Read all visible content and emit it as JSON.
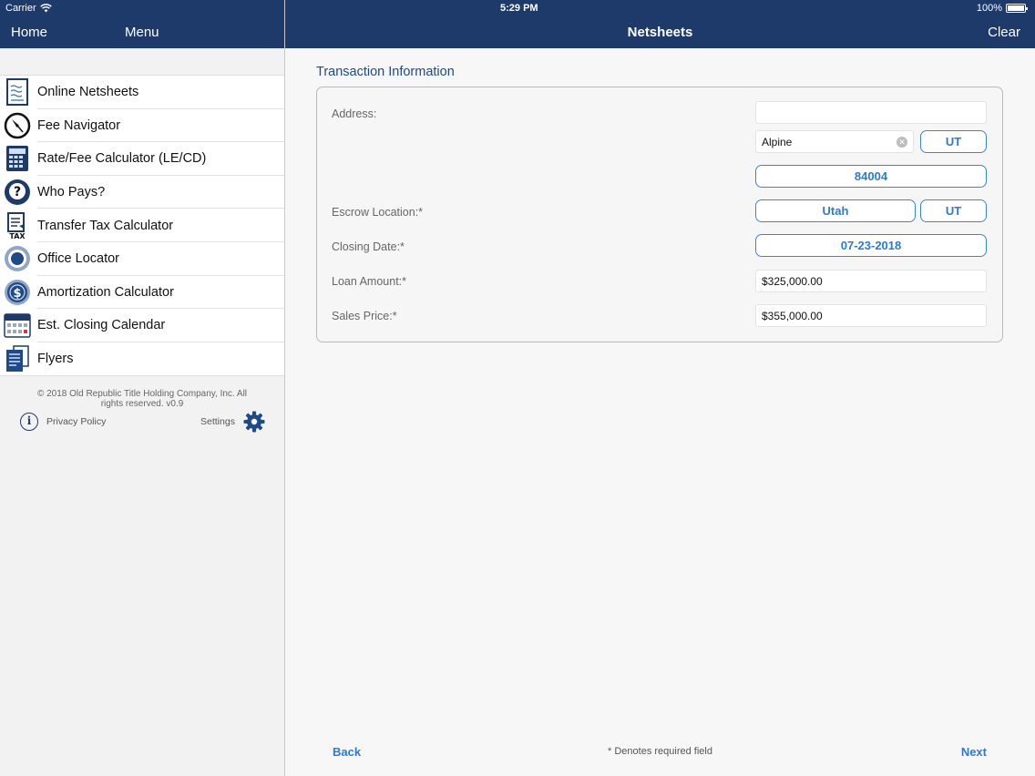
{
  "status_bar": {
    "carrier": "Carrier",
    "time": "5:29 PM",
    "battery": "100%"
  },
  "left_nav": {
    "home": "Home",
    "menu": "Menu"
  },
  "right_nav": {
    "title": "Netsheets",
    "clear": "Clear"
  },
  "menu": {
    "items": [
      {
        "label": "Online Netsheets",
        "icon": "netsheet-document-icon"
      },
      {
        "label": "Fee Navigator",
        "icon": "compass-icon"
      },
      {
        "label": "Rate/Fee Calculator (LE/CD)",
        "icon": "calculator-icon"
      },
      {
        "label": "Who Pays?",
        "icon": "question-circle-icon"
      },
      {
        "label": "Transfer Tax Calculator",
        "icon": "tax-document-icon"
      },
      {
        "label": "Office Locator",
        "icon": "location-target-icon"
      },
      {
        "label": "Amortization Calculator",
        "icon": "dollar-circle-icon"
      },
      {
        "label": "Est. Closing Calendar",
        "icon": "calendar-icon"
      },
      {
        "label": "Flyers",
        "icon": "flyers-icon"
      }
    ]
  },
  "footer": {
    "copyright": "© 2018 Old Republic Title Holding Company, Inc. All rights reserved. v0.9",
    "privacy": "Privacy Policy",
    "settings": "Settings"
  },
  "form": {
    "section_title": "Transaction Information",
    "address_label": "Address:",
    "address_value": "",
    "city_value": "Alpine",
    "city_state": "UT",
    "zip": "84004",
    "escrow_label": "Escrow Location:*",
    "escrow_location": "Utah",
    "escrow_state": "UT",
    "closing_label": "Closing Date:*",
    "closing_date": "07-23-2018",
    "loan_label": "Loan Amount:*",
    "loan_amount": "$325,000.00",
    "sales_label": "Sales Price:*",
    "sales_price": "$355,000.00"
  },
  "bottom": {
    "back": "Back",
    "note": "* Denotes required field",
    "next": "Next"
  },
  "colors": {
    "navbar": "#1e3a6b",
    "accent": "#2a7bd6"
  }
}
